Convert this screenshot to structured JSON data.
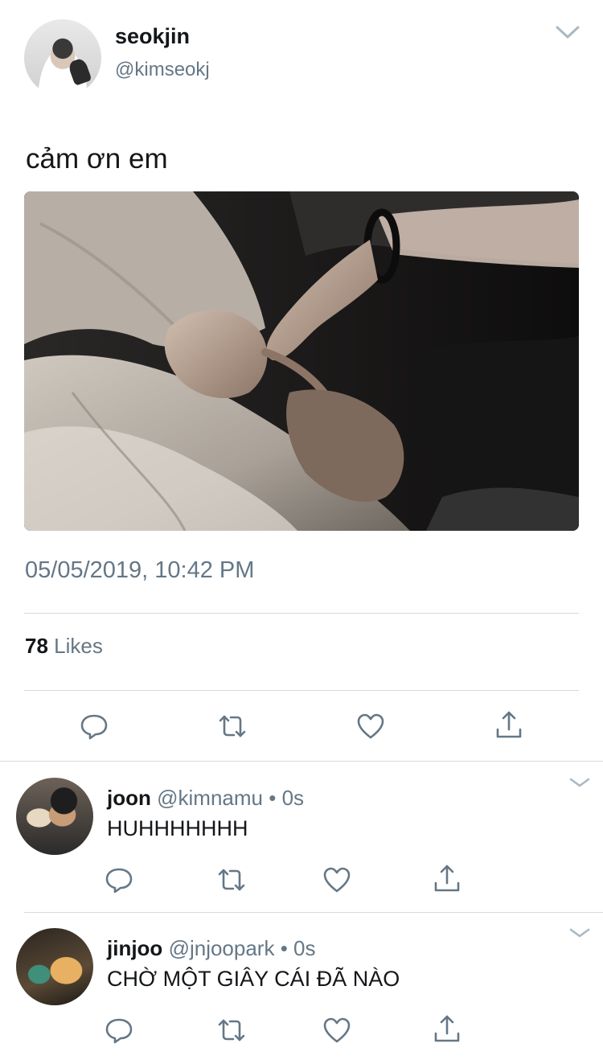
{
  "tweet": {
    "author": {
      "name": "seokjin",
      "handle": "@kimseokj"
    },
    "text": "cảm ơn em",
    "timestamp": "05/05/2019, 10:42 PM",
    "likes": {
      "count": "78",
      "label": "Likes"
    }
  },
  "actions": [
    "reply-icon",
    "retweet-icon",
    "like-icon",
    "share-icon"
  ],
  "replies": [
    {
      "name": "joon",
      "handle": "@kimnamu",
      "dot": "•",
      "time": "0s",
      "text": "HUHHHHHHH"
    },
    {
      "name": "jinjoo",
      "handle": "@jnjoopark",
      "dot": "•",
      "time": "0s",
      "text": "CHỜ MỘT GIÂY CÁI ĐÃ NÀO"
    }
  ],
  "colors": {
    "text": "#14171a",
    "secondary": "#657786",
    "icon": "#657786",
    "divider": "#d5dadd"
  }
}
